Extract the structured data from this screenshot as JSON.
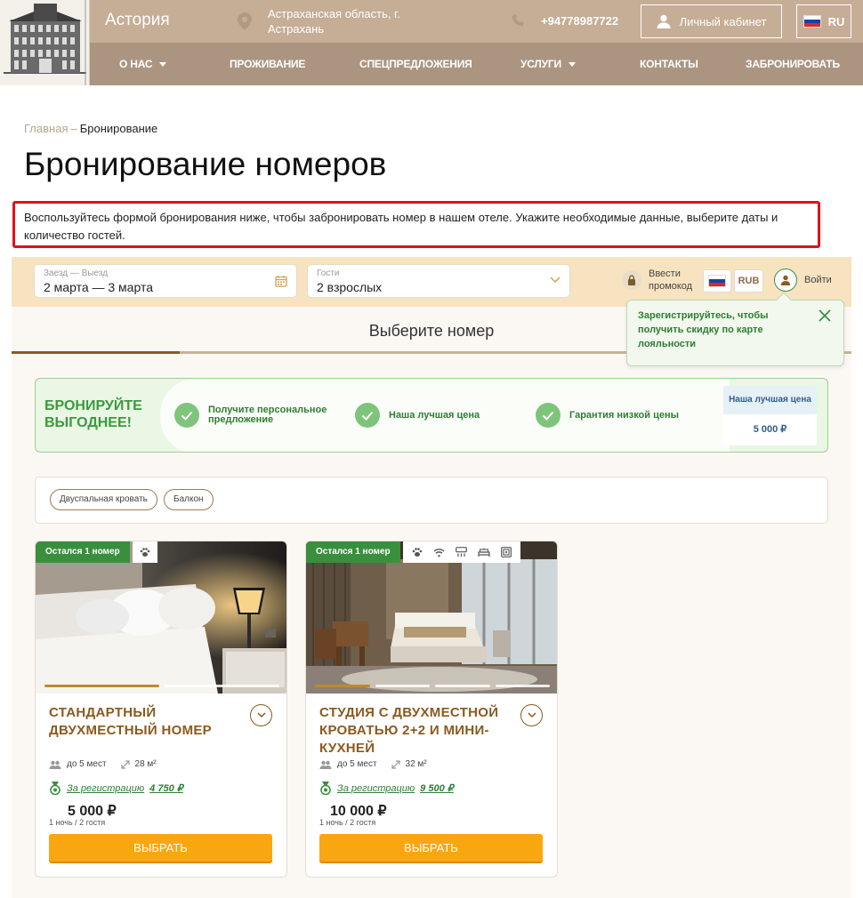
{
  "header": {
    "brand": "Астория",
    "address": "Астраханская область, г. Астрахань",
    "phone": "+94778987722",
    "cabinet_label": "Личный кабинет",
    "lang": "RU",
    "nav": [
      {
        "label": "О НАС",
        "dropdown": true
      },
      {
        "label": "ПРОЖИВАНИЕ"
      },
      {
        "label": "СПЕЦПРЕДЛОЖЕНИЯ"
      },
      {
        "label": "УСЛУГИ",
        "dropdown": true
      },
      {
        "label": "КОНТАКТЫ"
      },
      {
        "label": "ЗАБРОНИРОВАТЬ"
      }
    ]
  },
  "breadcrumb": {
    "home": "Главная",
    "separator": "–",
    "current": "Бронирование"
  },
  "page": {
    "title": "Бронирование номеров",
    "intro": "Воспользуйтесь формой бронирования ниже, чтобы забронировать номер в нашем отеле. Укажите необходимые данные, выберите даты и количество гостей."
  },
  "booking": {
    "dates": {
      "label": "Заезд — Выезд",
      "value": "2 марта — 3 марта"
    },
    "guests": {
      "label": "Гости",
      "value": "2 взрослых"
    },
    "promo_label": "Ввести промокод",
    "currency": "RUB",
    "login_label": "Войти",
    "step_title": "Выберите номер",
    "tooltip": "Зарегистрируйтесь, чтобы получить скидку по карте лояльности"
  },
  "banner": {
    "title": "БРОНИРУЙТЕ ВЫГОДНЕЕ!",
    "features": [
      "Получите персональное предложение",
      "Наша лучшая цена",
      "Гарантия низкой цены"
    ],
    "price_box": {
      "label": "Наша лучшая цена",
      "price": "5 000 ₽"
    }
  },
  "filters": [
    "Двуспальная кровать",
    "Балкон"
  ],
  "rooms": [
    {
      "badge": "Остался 1 номер",
      "amenities": [
        "paw-icon"
      ],
      "title": "СТАНДАРТНЫЙ ДВУХМЕСТНЫЙ НОМЕР",
      "capacity": "до 5 мест",
      "area": "28 м²",
      "reg_label": "За регистрацию",
      "reg_price": "4 750 ₽",
      "price": "5 000 ₽",
      "note": "1 ночь / 2 гостя",
      "button": "ВЫБРАТЬ"
    },
    {
      "badge": "Остался 1 номер",
      "amenities": [
        "paw-icon",
        "wifi-icon",
        "air-conditioner-icon",
        "bed-icon",
        "safe-icon"
      ],
      "title": "СТУДИЯ С ДВУХМЕСТНОЙ КРОВАТЬЮ 2+2 И МИНИ-КУХНЕЙ",
      "capacity": "до 5 мест",
      "area": "32 м²",
      "reg_label": "За регистрацию",
      "reg_price": "9 500 ₽",
      "price": "10 000 ₽",
      "note": "1 ночь / 2 гостя",
      "button": "ВЫБРАТЬ"
    }
  ],
  "colors": {
    "topbar": "#c5ad96",
    "navbar": "#ab9580",
    "accent_brown": "#8a5a1e",
    "green": "#3a8f3e",
    "orange_button": "#f9a711",
    "highlight_red": "#e0111b"
  }
}
